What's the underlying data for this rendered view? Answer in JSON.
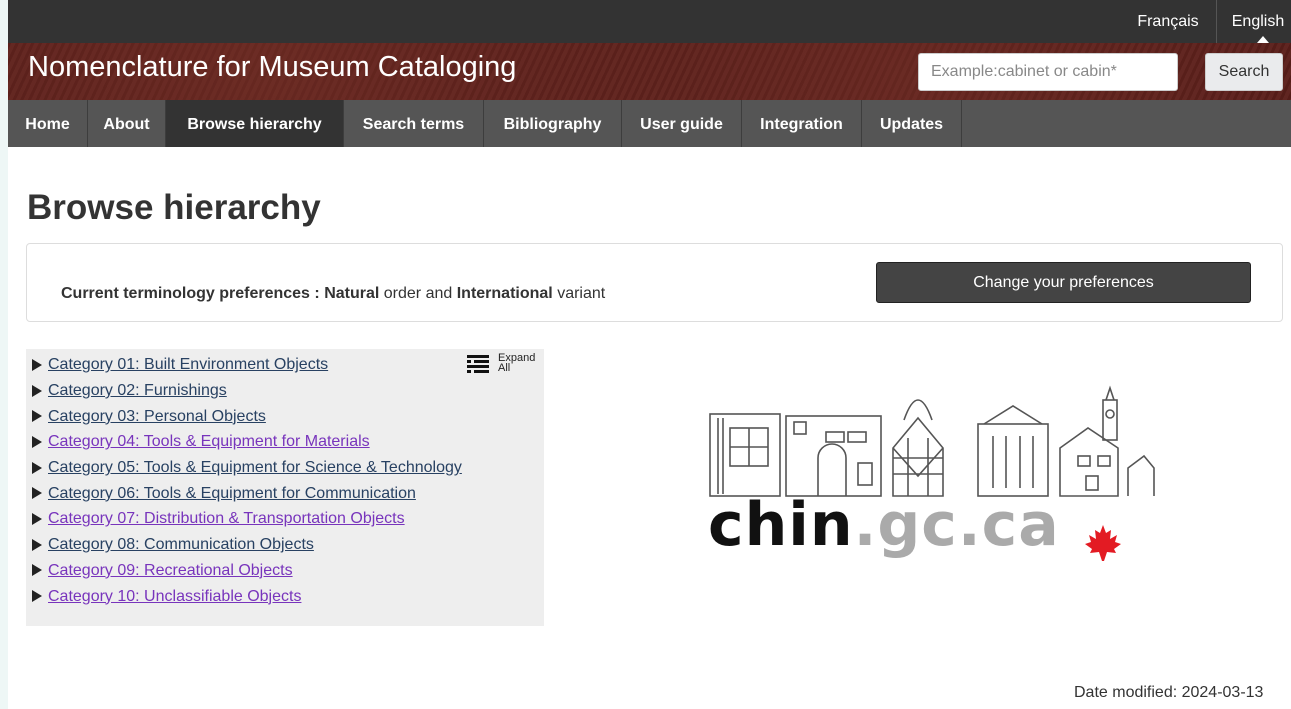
{
  "language": {
    "francais": "Français",
    "english": "English"
  },
  "header": {
    "site_title": "Nomenclature for Museum Cataloging",
    "search_placeholder": "Example:cabinet or cabin*",
    "search_button": "Search"
  },
  "menu": {
    "items": [
      {
        "label": "Home",
        "active": false
      },
      {
        "label": "About",
        "active": false
      },
      {
        "label": "Browse hierarchy",
        "active": true
      },
      {
        "label": "Search terms",
        "active": false
      },
      {
        "label": "Bibliography",
        "active": false
      },
      {
        "label": "User guide",
        "active": false
      },
      {
        "label": "Integration",
        "active": false
      },
      {
        "label": "Updates",
        "active": false
      }
    ]
  },
  "page": {
    "title": "Browse hierarchy"
  },
  "preferences": {
    "label": "Current terminology preferences :",
    "order_value": "Natural",
    "order_suffix": "order and",
    "variant_value": "International",
    "variant_suffix": "variant",
    "button": "Change your preferences"
  },
  "tree": {
    "expand_label_1": "Expand",
    "expand_label_2": "All",
    "categories": [
      {
        "label": "Category 01: Built Environment Objects",
        "visited": false
      },
      {
        "label": "Category 02: Furnishings",
        "visited": false
      },
      {
        "label": "Category 03: Personal Objects",
        "visited": false
      },
      {
        "label": "Category 04: Tools & Equipment for Materials",
        "visited": true
      },
      {
        "label": "Category 05: Tools & Equipment for Science & Technology",
        "visited": false
      },
      {
        "label": "Category 06: Tools & Equipment for Communication",
        "visited": false
      },
      {
        "label": "Category 07: Distribution & Transportation Objects",
        "visited": true
      },
      {
        "label": "Category 08: Communication Objects",
        "visited": false
      },
      {
        "label": "Category 09: Recreational Objects",
        "visited": true
      },
      {
        "label": "Category 10: Unclassifiable Objects",
        "visited": true
      }
    ]
  },
  "logo": {
    "text_main": "chin",
    "text_rest": ".gc.ca"
  },
  "footer": {
    "date_modified": "Date modified: 2024-03-13"
  },
  "colors": {
    "banner": "#5a1e1a",
    "menu": "#555555",
    "menu_active": "#333333",
    "link": "#284162",
    "link_visited": "#7834bc",
    "maple": "#e31b23"
  }
}
